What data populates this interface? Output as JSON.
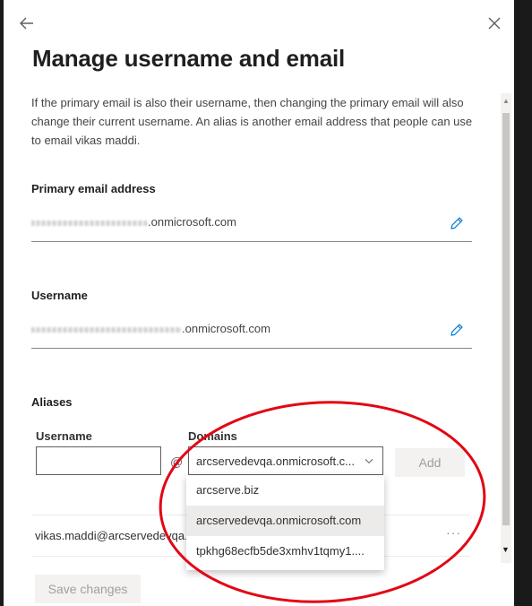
{
  "panel": {
    "title": "Manage username and email",
    "description": "If the primary email is also their username, then changing the primary email will also change their current username. An alias is another email address that people can use to email vikas maddi."
  },
  "primary_email": {
    "label": "Primary email address",
    "value_visible": ".onmicrosoft.com"
  },
  "username": {
    "label": "Username",
    "value_visible": ".onmicrosoft.com"
  },
  "aliases": {
    "label": "Aliases",
    "username_label": "Username",
    "at_sign": "@",
    "domains_label": "Domains",
    "selected_domain": "arcservedevqa.onmicrosoft.c...",
    "add_label": "Add",
    "dropdown_options": [
      "arcserve.biz",
      "arcservedevqa.onmicrosoft.com",
      "tpkhg68ecfb5de3xmhv1tqmy1...."
    ],
    "selected_option_index": 1,
    "existing_alias": "vikas.maddi@arcservedevqa.",
    "more_label": "···"
  },
  "footer": {
    "save_label": "Save changes"
  },
  "icons": {
    "back": "back-arrow-icon",
    "close": "close-icon",
    "edit": "pencil-icon",
    "chevron": "chevron-down-icon",
    "more": "more-icon"
  },
  "colors": {
    "accent": "#0078d4",
    "annotation": "#e30613",
    "disabled_bg": "#f3f2f1"
  }
}
